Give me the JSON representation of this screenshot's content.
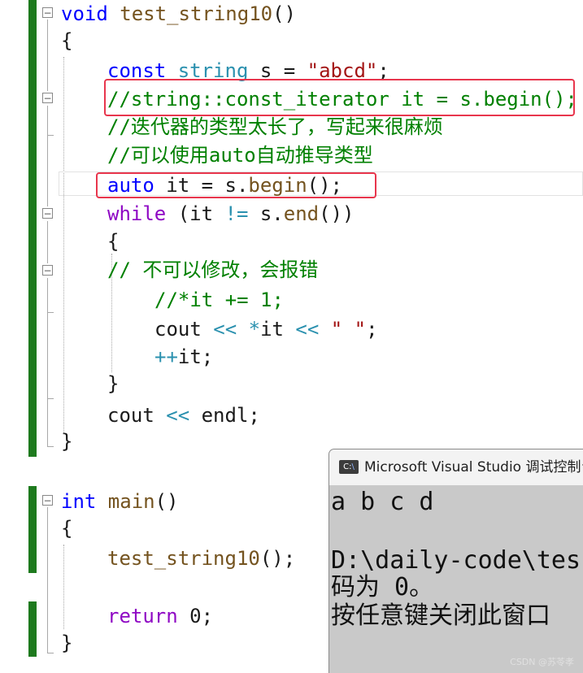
{
  "editor": {
    "fn1": {
      "sig_kw": "void",
      "sig_name": "test_string10",
      "sig_parens": "()",
      "open_brace": "{",
      "l1_kw": "const",
      "l1_ty": "string",
      "l1_rest": " s = ",
      "l1_str": "\"abcd\"",
      "l1_end": ";",
      "l2_comment": "//string::const_iterator it = s.begin();",
      "l3_comment": "//迭代器的类型太长了，写起来很麻烦",
      "l4_comment": "//可以使用auto自动推导类型",
      "l5_kw": "auto",
      "l5_rest": " it = s.",
      "l5_fn": "begin",
      "l5_end": "();",
      "l6_kw": "while",
      "l6_a": " (it ",
      "l6_op": "!=",
      "l6_b": " s.",
      "l6_fn": "end",
      "l6_c": "())",
      "l7_brace": "{",
      "l8_comment": "// 不可以修改，会报错",
      "l9_comment": "//*it += 1;",
      "l10_a": "cout ",
      "l10_op1": "<<",
      "l10_op2": " *",
      "l10_b": "it ",
      "l10_op3": "<<",
      "l10_sp": " ",
      "l10_str": "\" \"",
      "l10_end": ";",
      "l11_op": "++",
      "l11_b": "it;",
      "l12_brace": "}",
      "l13_a": "cout ",
      "l13_op": "<<",
      "l13_b": " endl;",
      "close_brace": "}"
    },
    "fn2": {
      "sig_kw": "int",
      "sig_name": " main",
      "sig_parens": "()",
      "open_brace": "{",
      "call_fn": "test_string10",
      "call_end": "();",
      "ret_kw": "return",
      "ret_rest": " 0;",
      "close_brace": "}"
    },
    "fold_minus": "−"
  },
  "console": {
    "icon_a": "C:",
    "icon_b": "\\",
    "title": "Microsoft Visual Studio 调试控制台",
    "line1": "a b c d",
    "line2": "D:\\daily-code\\tes",
    "line3": "码为 0。",
    "line4": "按任意键关闭此窗口",
    "watermark": "CSDN @苏苓孝"
  }
}
